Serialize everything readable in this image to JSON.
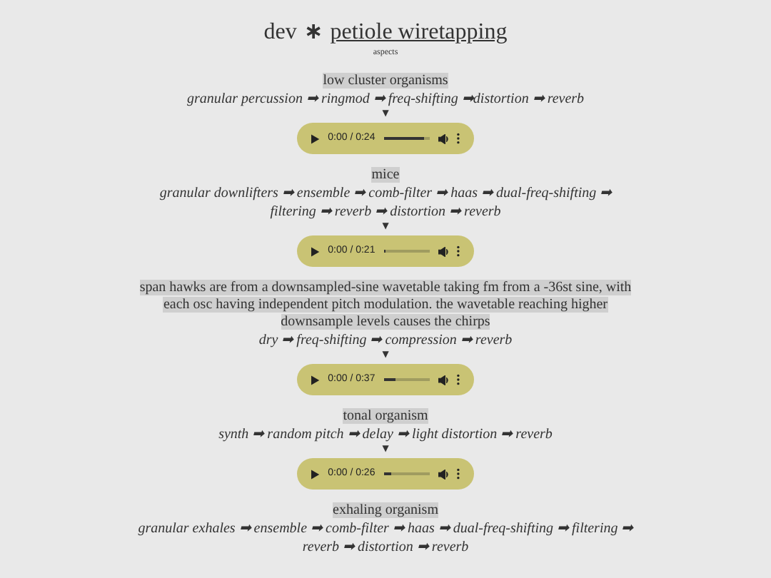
{
  "header": {
    "title_prefix": "dev",
    "separator": "∗",
    "title_link": "petiole wiretapping",
    "subtitle": "aspects"
  },
  "sections": [
    {
      "title": "low cluster organisms",
      "chain": "granular percussion ➡ ringmod ➡ freq-shifting ➡distortion ➡ reverb",
      "marker": "▼",
      "player": {
        "time": "0:00 / 0:24",
        "level": 0.9
      }
    },
    {
      "title": "mice",
      "chain": "granular downlifters ➡ ensemble ➡ comb-filter ➡ haas ➡ dual-freq-shifting ➡ filtering ➡ reverb ➡ distortion ➡ reverb",
      "marker": "▼",
      "player": {
        "time": "0:00 / 0:21",
        "level": 0.05
      }
    },
    {
      "title": "span hawks are from a downsampled-sine wavetable taking fm from a -36st sine, with each osc having independent pitch modulation. the wavetable reaching higher downsample levels causes the chirps",
      "chain": "dry ➡ freq-shifting ➡ compression ➡ reverb",
      "marker": "▼",
      "player": {
        "time": "0:00 / 0:37",
        "level": 0.25
      }
    },
    {
      "title": "tonal organism",
      "chain": "synth ➡ random pitch ➡ delay ➡ light distortion ➡ reverb",
      "marker": "▼",
      "player": {
        "time": "0:00 / 0:26",
        "level": 0.15
      }
    },
    {
      "title": "exhaling organism",
      "chain": "granular exhales ➡ ensemble ➡ comb-filter ➡ haas ➡ dual-freq-shifting ➡ filtering ➡ reverb ➡ distortion ➡ reverb"
    }
  ]
}
